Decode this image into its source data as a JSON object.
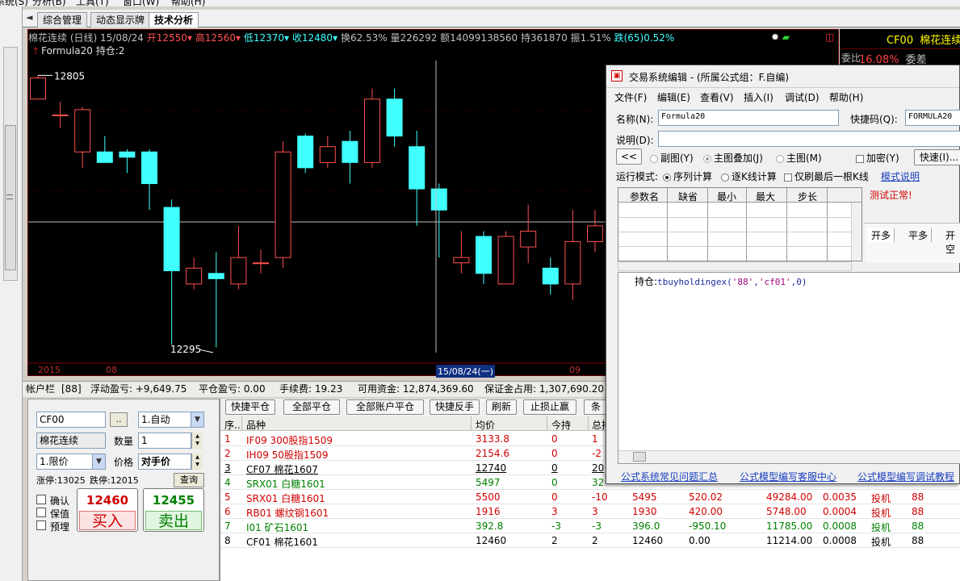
{
  "menu": {
    "items": [
      "系统(S)",
      "分析(B)",
      "工具(T)",
      "窗口(W)",
      "帮助(H)"
    ]
  },
  "tabs": {
    "nav": "◄",
    "items": [
      "综合管理",
      "动态显示牌",
      "技术分析"
    ],
    "active": "技术分析"
  },
  "chart": {
    "info": {
      "name": "棉花连续 (日线)",
      "date": "15/08/24",
      "open": "开12550",
      "high": "高12560",
      "low": "低12370",
      "close": "收12480",
      "turnover": "换62.53%",
      "volume": "量226292",
      "amount": "额14099138560",
      "open_interest": "持361870",
      "amplitude": "振1.51%",
      "change": "跌(65)0.52%"
    },
    "formula_label": "Formula20",
    "holding_label": "持仓:2",
    "high_label": "12805",
    "low_label": "12295",
    "date_axis": {
      "year": "2015",
      "month_1": "08",
      "cursor": "15/08/24(一)",
      "month_2": "09"
    }
  },
  "chart_data": {
    "type": "candlestick",
    "ylim": [
      12280,
      12830
    ],
    "candles": [
      {
        "o": 12760,
        "c": 12800,
        "h": 12805,
        "l": 12760
      },
      {
        "o": 12730,
        "c": 12730,
        "h": 12755,
        "l": 12705
      },
      {
        "o": 12660,
        "c": 12740,
        "h": 12745,
        "l": 12630
      },
      {
        "o": 12660,
        "c": 12640,
        "h": 12690,
        "l": 12640
      },
      {
        "o": 12660,
        "c": 12650,
        "h": 12665,
        "l": 12620
      },
      {
        "o": 12660,
        "c": 12600,
        "h": 12665,
        "l": 12550
      },
      {
        "o": 12555,
        "c": 12435,
        "h": 12570,
        "l": 12295
      },
      {
        "o": 12410,
        "c": 12440,
        "h": 12460,
        "l": 12400
      },
      {
        "o": 12430,
        "c": 12420,
        "h": 12470,
        "l": 12290
      },
      {
        "o": 12410,
        "c": 12460,
        "h": 12520,
        "l": 12400
      },
      {
        "o": 12450,
        "c": 12450,
        "h": 12475,
        "l": 12430
      },
      {
        "o": 12460,
        "c": 12660,
        "h": 12680,
        "l": 12440
      },
      {
        "o": 12690,
        "c": 12630,
        "h": 12695,
        "l": 12620
      },
      {
        "o": 12640,
        "c": 12670,
        "h": 12690,
        "l": 12630
      },
      {
        "o": 12680,
        "c": 12640,
        "h": 12700,
        "l": 12600
      },
      {
        "o": 12640,
        "c": 12760,
        "h": 12780,
        "l": 12630
      },
      {
        "o": 12760,
        "c": 12690,
        "h": 12780,
        "l": 12670
      },
      {
        "o": 12670,
        "c": 12590,
        "h": 12700,
        "l": 12520
      },
      {
        "o": 12590,
        "c": 12550,
        "h": 12600,
        "l": 12460
      },
      {
        "o": 12450,
        "c": 12460,
        "h": 12510,
        "l": 12430
      },
      {
        "o": 12500,
        "c": 12430,
        "h": 12510,
        "l": 12410
      },
      {
        "o": 12410,
        "c": 12500,
        "h": 12510,
        "l": 12410
      },
      {
        "o": 12480,
        "c": 12510,
        "h": 12560,
        "l": 12450
      },
      {
        "o": 12440,
        "c": 12410,
        "h": 12460,
        "l": 12390
      },
      {
        "o": 12410,
        "c": 12490,
        "h": 12550,
        "l": 12380
      },
      {
        "o": 12490,
        "c": 12520,
        "h": 12550,
        "l": 12470
      }
    ],
    "up_color": "#ff5050",
    "down_color": "#40ffff"
  },
  "quote": {
    "code": "CF00",
    "name": "棉花连续",
    "weibi_label": "委比",
    "weibi_value": "16.08%",
    "weicha_label": "委差"
  },
  "account": {
    "label": "帐户栏",
    "acct_no": "[88]",
    "float_pnl": "浮动盈亏: +9,649.75",
    "close_pnl": "平仓盈亏: 0.00",
    "fee": "手续费: 19.23",
    "available": "可用资金: 12,874,369.60",
    "margin": "保证金占用: 1,307,690.20"
  },
  "order": {
    "code": "CF00",
    "code_btn": "..",
    "mode": "1.自动",
    "name": "棉花连续",
    "qty_label": "数量",
    "qty": "1",
    "price_type": "1.限价",
    "price_label": "价格",
    "price_value": "对手价",
    "limit_up": "涨停:13025",
    "limit_down": "跌停:12015",
    "query_btn": "查询",
    "checks": [
      "确认",
      "保值",
      "预埋"
    ],
    "buy_price": "12460",
    "buy_label": "买入",
    "sell_price": "12455",
    "sell_label": "卖出"
  },
  "toolbar": [
    "快捷平仓",
    "全部平仓",
    "全部账户平仓",
    "快捷反手",
    "刷新",
    "止损止赢",
    "条"
  ],
  "positions": {
    "headers": [
      "序..",
      "品种",
      "均价",
      "今持",
      "总持"
    ],
    "rows": [
      {
        "no": "1",
        "name": "IF09 300股指1509",
        "avg": "3133.8",
        "today": "0",
        "total": "1",
        "c1": "",
        "c2": "",
        "c3": "",
        "c4": "",
        "c5": "",
        "c6": "",
        "color": "#d00000"
      },
      {
        "no": "2",
        "name": "IH09 50股指1509",
        "avg": "2154.6",
        "today": "0",
        "total": "-2",
        "c1": "",
        "c2": "",
        "c3": "",
        "c4": "",
        "c5": "",
        "c6": "",
        "color": "#d00000"
      },
      {
        "no": "3",
        "name": "CF07 棉花1607",
        "avg": "12740",
        "today": "0",
        "total": "20",
        "c1": "",
        "c2": "",
        "c3": "",
        "c4": "",
        "c5": "",
        "c6": "",
        "color": "#000000",
        "underline": true
      },
      {
        "no": "4",
        "name": "SRX01 白糖1601",
        "avg": "5497",
        "today": "0",
        "total": "32",
        "c1": "",
        "c2": "",
        "c3": "",
        "c4": "",
        "c5": "",
        "c6": "",
        "color": "#008000"
      },
      {
        "no": "5",
        "name": "SRX01 白糖1601",
        "avg": "5500",
        "today": "0",
        "total": "-10",
        "c1": "5495",
        "c2": "520.02",
        "c3": "49284.00",
        "c4": "0.0035",
        "c5": "投机",
        "c6": "88",
        "color": "#d00000"
      },
      {
        "no": "6",
        "name": "RB01 螺纹钢1601",
        "avg": "1916",
        "today": "3",
        "total": "3",
        "c1": "1930",
        "c2": "420.00",
        "c3": "5748.00",
        "c4": "0.0004",
        "c5": "投机",
        "c6": "88",
        "color": "#d00000"
      },
      {
        "no": "7",
        "name": "I01 矿石1601",
        "avg": "392.8",
        "today": "-3",
        "total": "-3",
        "c1": "396.0",
        "c2": "-950.10",
        "c3": "11785.00",
        "c4": "0.0008",
        "c5": "投机",
        "c6": "88",
        "color": "#008000"
      },
      {
        "no": "8",
        "name": "CF01 棉花1601",
        "avg": "12460",
        "today": "2",
        "total": "2",
        "c1": "12460",
        "c2": "0.00",
        "c3": "11214.00",
        "c4": "0.0008",
        "c5": "投机",
        "c6": "88",
        "color": "#000000"
      }
    ]
  },
  "editor": {
    "title": "交易系统编辑 - (所属公式组：F.自编)",
    "menu": [
      "文件(F)",
      "编辑(E)",
      "查看(V)",
      "插入(I)",
      "调试(D)",
      "帮助(H)"
    ],
    "name_label": "名称(N):",
    "name_value": "Formula20",
    "shortcut_label": "快捷码(Q):",
    "shortcut_value": "FORMULA20",
    "desc_label": "说明(D):",
    "desc_value": "",
    "back_btn": "<<",
    "opt_sub": "副图(Y)",
    "opt_overlay": "主图叠加(J)",
    "opt_main": "主图(M)",
    "encrypt": "加密(Y)",
    "fast_btn": "快速(I)...",
    "run_mode_label": "运行模式:",
    "run_seq": "序列计算",
    "run_tick": "逐K线计算",
    "last_only": "仅刷最后一根K线",
    "mode_link": "模式说明",
    "param_headers": [
      "参数名",
      "缺省",
      "最小",
      "最大",
      "步长"
    ],
    "status": "测试正常!",
    "mini_tabs": [
      "开多",
      "平多",
      "开空"
    ],
    "code_label": "持仓:",
    "code_func": "tbuyholdingex",
    "code_args_1": "'88'",
    "code_args_2": "'cf01'",
    "code_args_3": "0",
    "links": [
      "公式系统常见问题汇总",
      "公式模型编写客服中心",
      "公式模型编写调试教程"
    ]
  }
}
